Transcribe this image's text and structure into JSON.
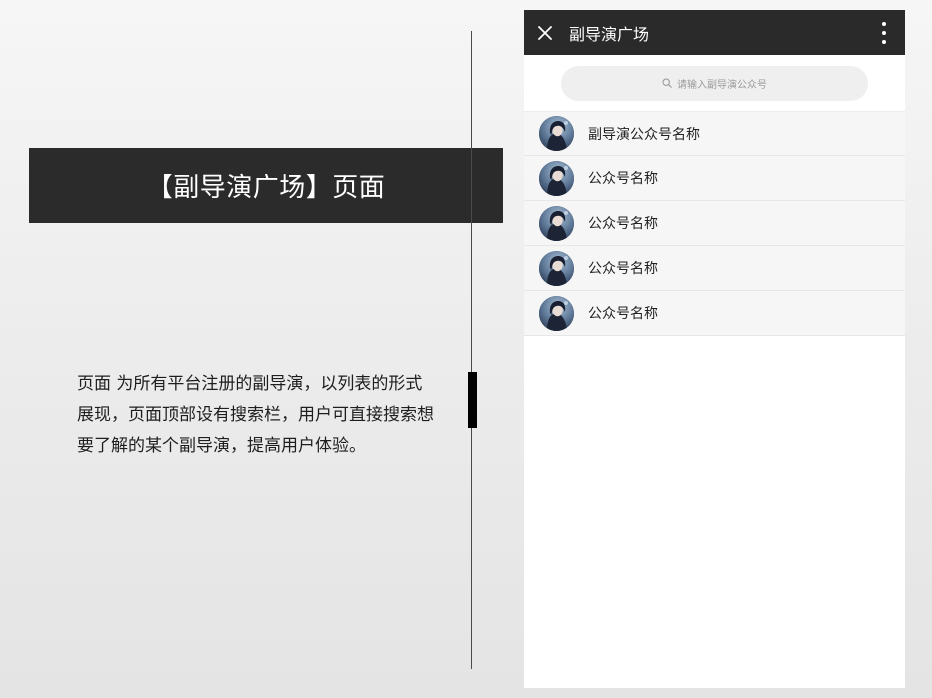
{
  "banner": {
    "title": "【副导演广场】页面"
  },
  "description": {
    "text": "页面 为所有平台注册的副导演，以列表的形式展现，页面顶部设有搜索栏，用户可直接搜索想要了解的某个副导演，提高用户体验。"
  },
  "phone": {
    "app_bar": {
      "title": "副导演广场",
      "close_icon": "close-icon",
      "more_icon": "more-vertical-icon"
    },
    "search": {
      "placeholder": "请输入副导演公众号",
      "icon": "search-icon"
    },
    "accounts": [
      {
        "name": "副导演公众号名称"
      },
      {
        "name": "公众号名称"
      },
      {
        "name": "公众号名称"
      },
      {
        "name": "公众号名称"
      },
      {
        "name": "公众号名称"
      }
    ]
  },
  "colors": {
    "banner_bg": "#2b2b2b",
    "app_bar_bg": "#2a2a2a",
    "list_bg": "#f6f6f6",
    "search_bg": "#efefef"
  }
}
